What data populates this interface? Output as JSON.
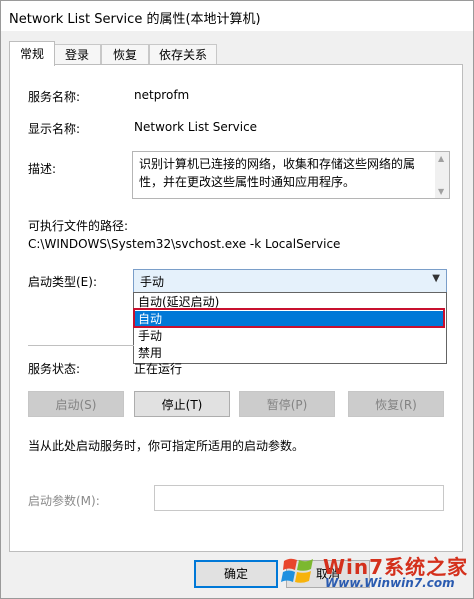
{
  "window": {
    "title": "Network List Service 的属性(本地计算机)"
  },
  "tabs": [
    "常规",
    "登录",
    "恢复",
    "依存关系"
  ],
  "general": {
    "service_name_label": "服务名称:",
    "service_name_value": "netprofm",
    "display_name_label": "显示名称:",
    "display_name_value": "Network List Service",
    "description_label": "描述:",
    "description_text": "识别计算机已连接的网络，收集和存储这些网络的属性，并在更改这些属性时通知应用程序。",
    "path_label": "可执行文件的路径:",
    "path_value": "C:\\WINDOWS\\System32\\svchost.exe -k LocalService",
    "startup_type_label": "启动类型(E):",
    "startup_type_value": "手动",
    "startup_options": [
      "自动(延迟启动)",
      "自动",
      "手动",
      "禁用"
    ],
    "highlighted_option": "自动",
    "service_status_label": "服务状态:",
    "service_status_value": "正在运行",
    "buttons": {
      "start": "启动(S)",
      "stop": "停止(T)",
      "pause": "暂停(P)",
      "resume": "恢复(R)"
    },
    "hint_text": "当从此处启动服务时，你可指定所适用的启动参数。",
    "start_params_label": "启动参数(M):",
    "start_params_value": ""
  },
  "footer": {
    "ok": "确定",
    "cancel": "取消"
  },
  "watermark": {
    "brand": "Win7系统之家",
    "url": "Www.Winwin7.com"
  },
  "colors": {
    "selection": "#0078d7",
    "highlight_box": "#c8102e",
    "combo_bg": "#e5f1fb"
  },
  "icons": {
    "combo_arrow": "chevron-down-icon",
    "scroll_up": "triangle-up-icon",
    "scroll_down": "triangle-down-icon",
    "watermark_logo": "windows-logo-icon"
  }
}
